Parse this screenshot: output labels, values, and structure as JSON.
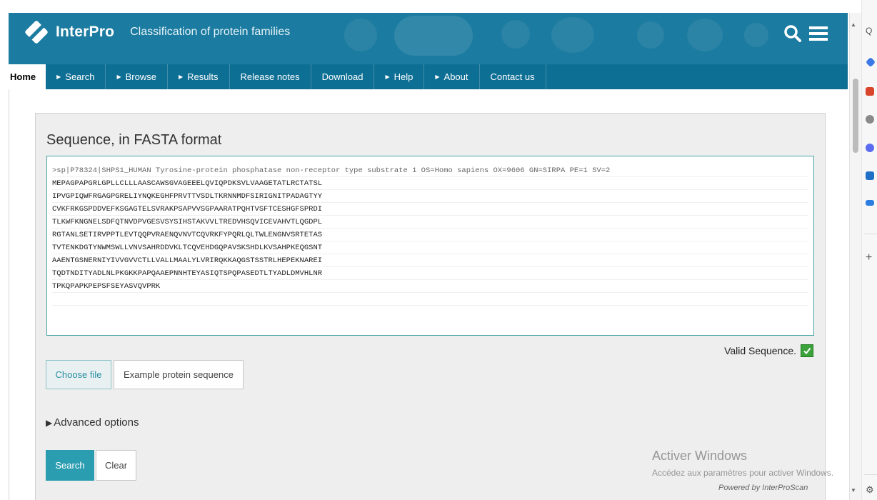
{
  "header": {
    "brand": "InterPro",
    "tagline": "Classification of protein families"
  },
  "nav": {
    "items": [
      {
        "label": "Home",
        "arrow": false,
        "active": true
      },
      {
        "label": "Search",
        "arrow": true
      },
      {
        "label": "Browse",
        "arrow": true
      },
      {
        "label": "Results",
        "arrow": true
      },
      {
        "label": "Release notes",
        "arrow": false
      },
      {
        "label": "Download",
        "arrow": false
      },
      {
        "label": "Help",
        "arrow": true
      },
      {
        "label": "About",
        "arrow": true
      },
      {
        "label": "Contact us",
        "arrow": false
      }
    ]
  },
  "form": {
    "title": "Sequence, in FASTA format",
    "sequence_lines": [
      ">sp|P78324|SHPS1_HUMAN Tyrosine-protein phosphatase non-receptor type substrate 1 OS=Homo sapiens OX=9606 GN=SIRPA PE=1 SV=2",
      "MEPAGPAPGRLGPLLCLLLAASCAWSGVAGEEELQVIQPDKSVLVAAGETATLRCTATSL",
      "IPVGPIQWFRGAGPGRELIYNQKEGHFPRVTTVSDLTKRNNMDFSIRIGNITPADAGTYY",
      "CVKFRKGSPDDVEFKSGAGTELSVRAKPSAPVVSGPAARATPQHTVSFTCESHGFSPRDI",
      "TLKWFKNGNELSDFQTNVDPVGESVSYSIHSTAKVVLTREDVHSQVICEVAHVTLQGDPL",
      "RGTANLSETIRVPPTLEVTQQPVRAENQVNVTCQVRKFYPQRLQLTWLENGNVSRTETAS",
      "TVTENKDGTYNWMSWLLVNVSAHRDDVKLTCQVEHDGQPAVSKSHDLKVSAHPKEQGSNT",
      "AAENTGSNERNIYIVVGVVCTLLVALLMAALYLVRIRQKKAQGSTSSTRLHEPEKNAREI",
      "TQDTNDITYADLNLPKGKKPAPQAAEPNNHTEYASIQTSPQPASEDTLTYADLDMVHLNR",
      "TPKQPAPKPEPSFSEYASVQVPRK"
    ],
    "valid_label": "Valid Sequence.",
    "choose_file": "Choose file",
    "example_button": "Example protein sequence",
    "advanced_options": "Advanced options",
    "search_button": "Search",
    "clear_button": "Clear",
    "powered_by": "Powered by InterProScan"
  },
  "overlay": {
    "activate_title": "Activer Windows",
    "activate_sub": "Accédez aux paramètres pour activer Windows."
  },
  "sidebar_icons": [
    "search-icon",
    "diamond-icon",
    "toolbox-icon",
    "people-icon",
    "copilot-icon",
    "outlook-icon",
    "send-icon",
    "plus-icon",
    "settings-icon"
  ],
  "colors": {
    "header": "#1b7ba0",
    "nav": "#0e6f94",
    "accent": "#2b9db0",
    "valid_check": "#3ba13b"
  }
}
